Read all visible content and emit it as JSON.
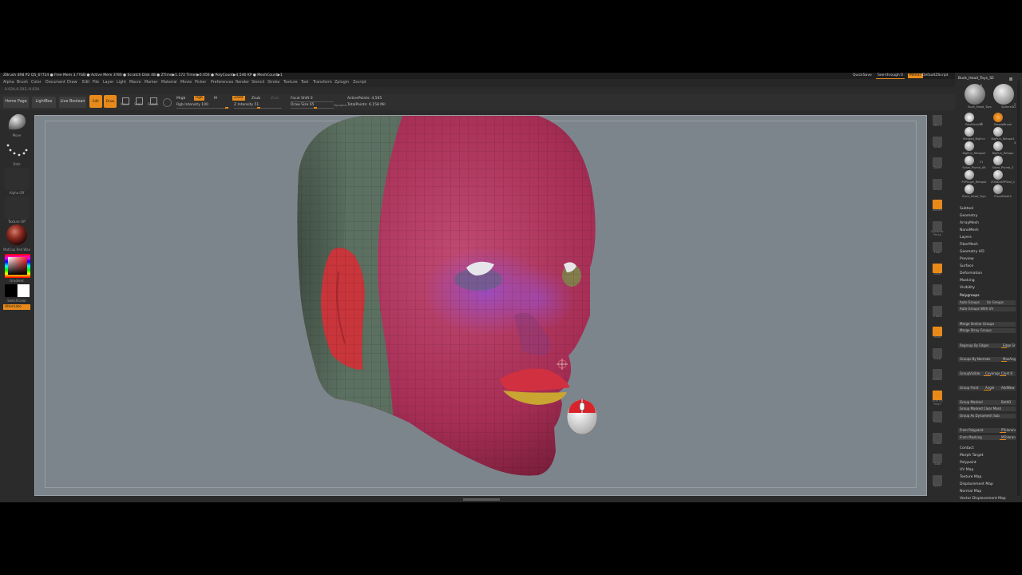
{
  "title_bar": {
    "text": "ZBrush 4R8 P2    QS_6?724 ● Free Mem 3.??GB ● Active Mem 3?80 ● Scratch Disk 48 ● ZTime▶1.172 Timer▶0.056 ● PolyCount▶4,546 KP ● MeshCount▶1"
  },
  "top_right": {
    "quicksave": "QuickSave",
    "see_through": "See-through  0",
    "menus": "Menus",
    "default_script": "DefaultZScript"
  },
  "menu_items": [
    "Alpha",
    "Brush",
    "Color",
    "Document",
    "Draw",
    "Edit",
    "File",
    "Layer",
    "Light",
    "Macro",
    "Marker",
    "Material",
    "Movie",
    "Picker",
    "Preferences",
    "Render",
    "Stencil",
    "Stroke",
    "Texture",
    "Tool",
    "Transform",
    "Zplugin",
    "Zscript"
  ],
  "coords": "0.024,0.202,-0.634",
  "toolbar": {
    "home_page": "Home Page",
    "lightbox": "LightBox",
    "live_boolean": "Live Boolean",
    "edit": "Edit",
    "draw": "Draw",
    "move": "Move",
    "scale": "Scale",
    "rotate": "Rotate",
    "mrgb": "Mrgb",
    "rgb": "Rgb",
    "m": "M",
    "rgb_intensity": "Rgb Intensity 100",
    "zadd": "Zadd",
    "zsub": "Zsub",
    "zcut": "Zcut",
    "z_intensity": "Z Intensity 51",
    "focal_shift": "Focal Shift 0",
    "draw_size": "Draw Size 65",
    "dynamic": "Dynamic",
    "active_points": "ActivePoints: 4,565",
    "total_points": "TotalPoints: 6.158 Mil"
  },
  "left_shelf": {
    "brush_label": "Move",
    "stroke_label": "Dots",
    "alpha_label": "Alpha Off",
    "texture_label": "Texture Off",
    "material_label": "MatCap Red Wax",
    "gradient_label": "Gradient",
    "switch_color_label": "SwitchColor",
    "alternate_label": "Alternate"
  },
  "right_shelf": [
    "SPix 3",
    "Scroll",
    "Zoom",
    "Actual",
    "AAHalf",
    "Dynamic Persp",
    "Floor",
    "Local",
    "Gizmo",
    "Frame",
    "Move",
    "Scale",
    "Rotate",
    "Line Fill PolyF",
    "Transp",
    "Ghost",
    "Solo",
    "Xpose"
  ],
  "tool_palette": {
    "header_name": "Buck_Head_Toys_SE",
    "thumbs": [
      "Buck_Head_Toys",
      "Sphere3D",
      "PolyMesh3D",
      "SimpleBrush",
      "Merged_BigFun",
      "BigPun_Retopo1",
      "BigPun_Retopo2",
      "BigPun_Retopo",
      "Salzo_Plumb_Alt",
      "Salzo_Plumb_3",
      "P2Plugin_Retopol",
      "ZONEd4PPSbd_1",
      "Buck_Head_Toys",
      "PlaneMask3"
    ],
    "thumb_counts": [
      "6",
      "2",
      "4",
      "3",
      "21"
    ],
    "sections": [
      "Subtool",
      "Geometry",
      "ArrayMesh",
      "NanoMesh",
      "Layers",
      "FiberMesh",
      "Geometry HD",
      "Preview",
      "Surface",
      "Deformation",
      "Masking",
      "Visibility"
    ],
    "polygroups": {
      "title": "Polygroups",
      "auto_groups": "Auto Groups",
      "uv_groups": "Uv Groups",
      "auto_groups_with_uv": "Auto Groups With UV",
      "merge_similar": "Merge Similar Groups",
      "merge_stray": "Merge Stray Groups",
      "regroup_by_edges": "Regroup By Edges",
      "edge_s": "Edge Sr",
      "groups_by_normals": "Groups By Normals",
      "max_ang": "MaxAng",
      "group_visible": "GroupVisible",
      "coverage": "Coverage",
      "clust": "Clust 8",
      "group_front": "Group Front",
      "angle": "Angle",
      "add_new": "AddNew",
      "group_masked": "Group Masked",
      "both_d": "BothD",
      "group_masked_clear": "Group Masked Clear Mask",
      "group_as_dynamesh": "Group As Dynamesh Sub",
      "from_polypaint": "From Polypaint",
      "p_tolerance": "PTolerance",
      "from_masking": "From Masking",
      "m_tolerance": "MTolerance"
    },
    "bottom_sections": [
      "Contact",
      "Morph Target",
      "Polypaint",
      "UV Map",
      "Texture Map",
      "Displacement Map",
      "Normal Map",
      "Vector Displacement Map"
    ]
  },
  "colors": {
    "accent": "#e88a1a",
    "viewport_bg": "#7d858c",
    "ui_bg": "#2b2b2b",
    "head_main": "#b4365c",
    "head_purple": "#8a3fa0",
    "head_green": "#5b7060",
    "head_red": "#c8353a",
    "lips_yellow": "#c9a531"
  },
  "icons": {
    "mouse_overlay": "mouse-icon",
    "cursor": "crosshair-cursor-icon"
  }
}
